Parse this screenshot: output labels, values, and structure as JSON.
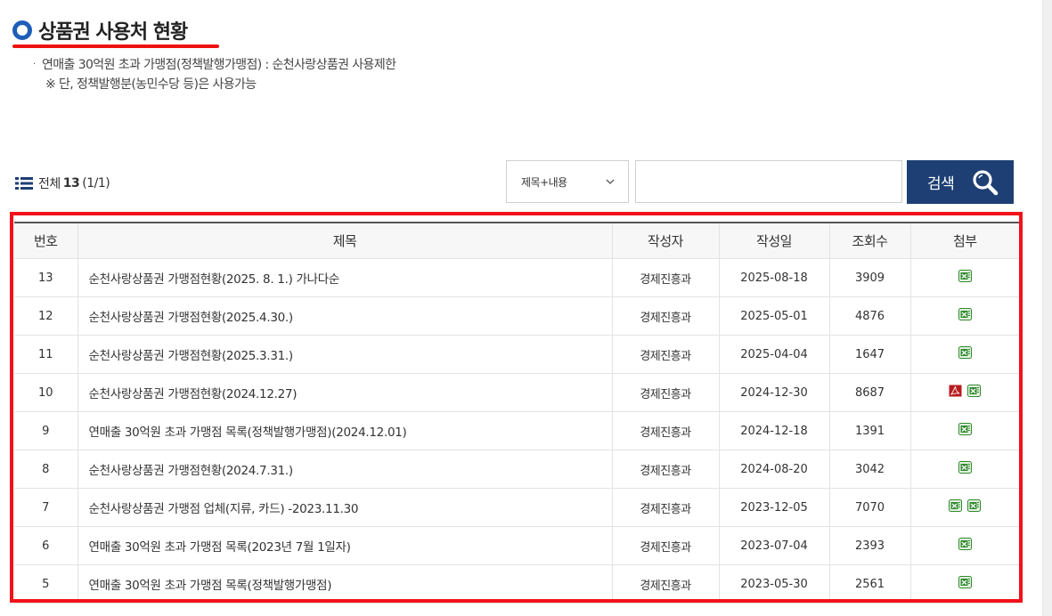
{
  "page": {
    "title": "상품권 사용처 현황",
    "notes": [
      "연매출 30억원 초과 가맹점(정책발행가맹점) : 순천사랑상품권 사용제한",
      "※ 단, 정책발행분(농민수당 등)은 사용가능"
    ]
  },
  "summary": {
    "prefix": "전체",
    "total": "13",
    "pages": "(1/1)"
  },
  "search": {
    "option_selected": "제목+내용",
    "input_value": "",
    "button_label": "검색"
  },
  "colors": {
    "title_icon": "#1d5fb8",
    "underline": "#ee1111",
    "frame": "#f2121a",
    "search_button": "#1d3f73",
    "excel_icon": "#2f8a2f",
    "pdf_icon": "#b81c1c"
  },
  "table": {
    "headers": [
      "번호",
      "제목",
      "작성자",
      "작성일",
      "조회수",
      "첨부"
    ],
    "rows": [
      {
        "no": "13",
        "title": "순천사랑상품권 가맹점현황(2025. 8. 1.) 가나다순",
        "author": "경제진흥과",
        "date": "2025-08-18",
        "views": "3909",
        "attachments": [
          "excel-icon"
        ]
      },
      {
        "no": "12",
        "title": "순천사랑상품권 가맹점현황(2025.4.30.)",
        "author": "경제진흥과",
        "date": "2025-05-01",
        "views": "4876",
        "attachments": [
          "excel-icon"
        ]
      },
      {
        "no": "11",
        "title": "순천사랑상품권 가맹점현황(2025.3.31.)",
        "author": "경제진흥과",
        "date": "2025-04-04",
        "views": "1647",
        "attachments": [
          "excel-icon"
        ]
      },
      {
        "no": "10",
        "title": "순천사랑상품권 가맹점현황(2024.12.27)",
        "author": "경제진흥과",
        "date": "2024-12-30",
        "views": "8687",
        "attachments": [
          "pdf-icon",
          "excel-icon"
        ]
      },
      {
        "no": "9",
        "title": "연매출 30억원 초과 가맹점 목록(정책발행가맹점)(2024.12.01)",
        "author": "경제진흥과",
        "date": "2024-12-18",
        "views": "1391",
        "attachments": [
          "excel-icon"
        ]
      },
      {
        "no": "8",
        "title": "순천사랑상품권 가맹점현황(2024.7.31.)",
        "author": "경제진흥과",
        "date": "2024-08-20",
        "views": "3042",
        "attachments": [
          "excel-icon"
        ]
      },
      {
        "no": "7",
        "title": "순천사랑상품권 가맹점 업체(지류, 카드) -2023.11.30",
        "author": "경제진흥과",
        "date": "2023-12-05",
        "views": "7070",
        "attachments": [
          "excel-icon",
          "excel-icon"
        ]
      },
      {
        "no": "6",
        "title": "연매출 30억원 초과 가맹점 목록(2023년 7월 1일자)",
        "author": "경제진흥과",
        "date": "2023-07-04",
        "views": "2393",
        "attachments": [
          "excel-icon"
        ]
      },
      {
        "no": "5",
        "title": "연매출 30억원 초과 가맹점 목록(정책발행가맹점)",
        "author": "경제진흥과",
        "date": "2023-05-30",
        "views": "2561",
        "attachments": [
          "excel-icon"
        ]
      }
    ]
  }
}
